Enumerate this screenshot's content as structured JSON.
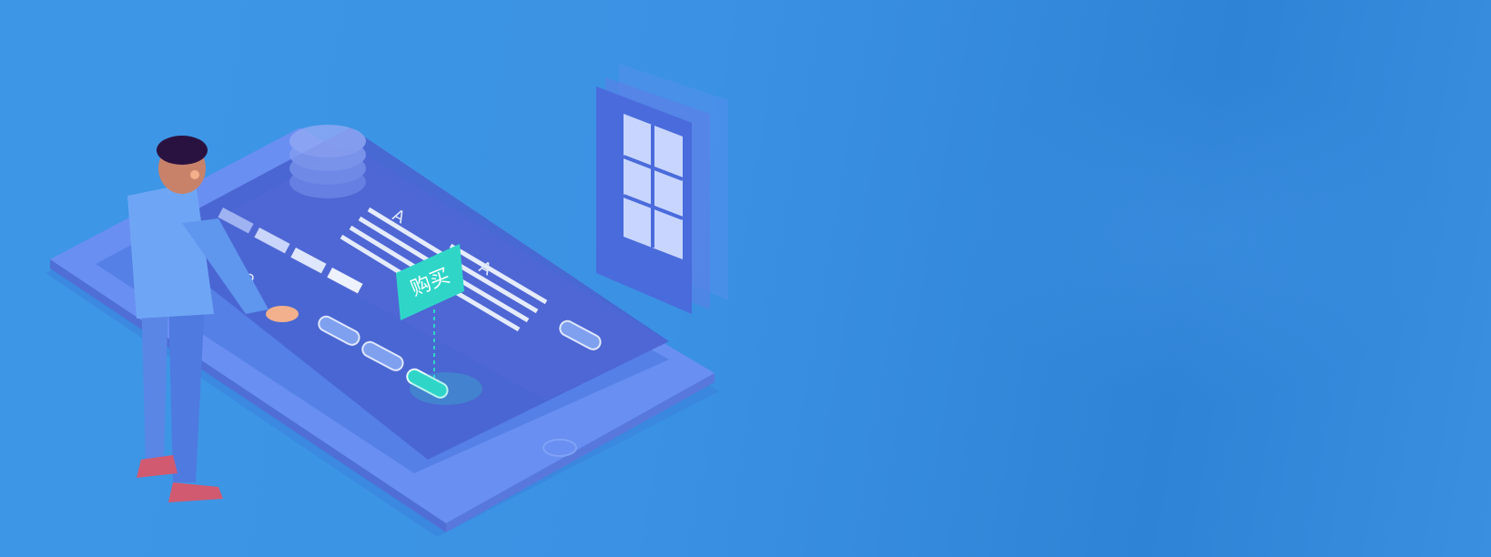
{
  "hero": {
    "buy_tag_label": "购买",
    "glyph_a": "A",
    "glyph_a2": "A",
    "digits": "00"
  },
  "colors": {
    "background": "#3e97e6",
    "tablet": "#5f8ff0",
    "screen": "#4a6fd8",
    "tag": "#2fd6c8",
    "figure_shirt": "#6ea6f5"
  }
}
